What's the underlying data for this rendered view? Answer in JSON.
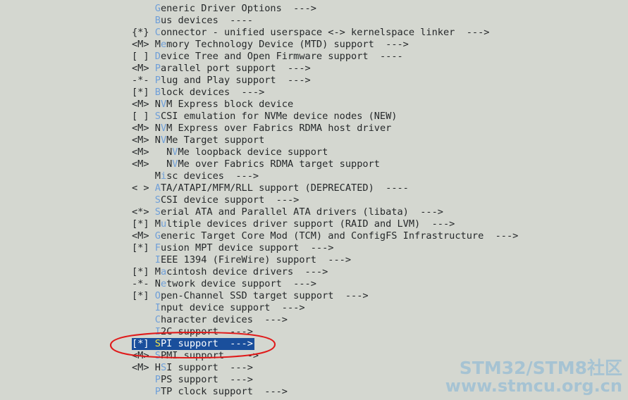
{
  "screen": {
    "kind": "linux-kernel-menuconfig",
    "background_color": "#d4d7d0",
    "text_color": "#25282a",
    "hotkey_color": "#6f9fd8",
    "selected_bg_color": "#1a4f9c",
    "selected_text_color": "#ffffff",
    "selected_hotkey_color": "#f2e64a",
    "annotation_color": "#e01b1b"
  },
  "menu": {
    "rows": [
      {
        "prefix": "    ",
        "pre_label": "",
        "hotkey": "G",
        "post_label": "eneric Driver Options",
        "arrow": "  --->",
        "selected": false
      },
      {
        "prefix": "    ",
        "pre_label": "",
        "hotkey": "B",
        "post_label": "us devices",
        "arrow": "  ----",
        "selected": false
      },
      {
        "prefix": "{*} ",
        "pre_label": "",
        "hotkey": "C",
        "post_label": "onnector - unified userspace <-> kernelspace linker",
        "arrow": "  --->",
        "selected": false
      },
      {
        "prefix": "<M> ",
        "pre_label": "M",
        "hotkey": "e",
        "post_label": "mory Technology Device (MTD) support",
        "arrow": "  --->",
        "selected": false
      },
      {
        "prefix": "[ ] ",
        "pre_label": "",
        "hotkey": "D",
        "post_label": "evice Tree and Open Firmware support",
        "arrow": "  ----",
        "selected": false
      },
      {
        "prefix": "<M> ",
        "pre_label": "",
        "hotkey": "P",
        "post_label": "arallel port support",
        "arrow": "  --->",
        "selected": false
      },
      {
        "prefix": "-*- ",
        "pre_label": "",
        "hotkey": "P",
        "post_label": "lug and Play support",
        "arrow": "  --->",
        "selected": false
      },
      {
        "prefix": "[*] ",
        "pre_label": "",
        "hotkey": "B",
        "post_label": "lock devices",
        "arrow": "  --->",
        "selected": false
      },
      {
        "prefix": "<M> ",
        "pre_label": "N",
        "hotkey": "V",
        "post_label": "M Express block device",
        "arrow": "",
        "selected": false
      },
      {
        "prefix": "[ ] ",
        "pre_label": "",
        "hotkey": "S",
        "post_label": "CSI emulation for NVMe device nodes (NEW)",
        "arrow": "",
        "selected": false
      },
      {
        "prefix": "<M> ",
        "pre_label": "N",
        "hotkey": "V",
        "post_label": "M Express over Fabrics RDMA host driver",
        "arrow": "",
        "selected": false
      },
      {
        "prefix": "<M> ",
        "pre_label": "N",
        "hotkey": "V",
        "post_label": "Me Target support",
        "arrow": "",
        "selected": false
      },
      {
        "prefix": "<M>   ",
        "pre_label": "N",
        "hotkey": "V",
        "post_label": "Me loopback device support",
        "arrow": "",
        "selected": false
      },
      {
        "prefix": "<M>   ",
        "pre_label": "N",
        "hotkey": "V",
        "post_label": "Me over Fabrics RDMA target support",
        "arrow": "",
        "selected": false
      },
      {
        "prefix": "    ",
        "pre_label": "M",
        "hotkey": "i",
        "post_label": "sc devices",
        "arrow": "  --->",
        "selected": false
      },
      {
        "prefix": "< > ",
        "pre_label": "",
        "hotkey": "A",
        "post_label": "TA/ATAPI/MFM/RLL support (DEPRECATED)",
        "arrow": "  ----",
        "selected": false
      },
      {
        "prefix": "    ",
        "pre_label": "",
        "hotkey": "S",
        "post_label": "CSI device support",
        "arrow": "  --->",
        "selected": false
      },
      {
        "prefix": "<*> ",
        "pre_label": "",
        "hotkey": "S",
        "post_label": "erial ATA and Parallel ATA drivers (libata)",
        "arrow": "  --->",
        "selected": false
      },
      {
        "prefix": "[*] ",
        "pre_label": "M",
        "hotkey": "u",
        "post_label": "ltiple devices driver support (RAID and LVM)",
        "arrow": "  --->",
        "selected": false
      },
      {
        "prefix": "<M> ",
        "pre_label": "",
        "hotkey": "G",
        "post_label": "eneric Target Core Mod (TCM) and ConfigFS Infrastructure",
        "arrow": "  --->",
        "selected": false
      },
      {
        "prefix": "[*] ",
        "pre_label": "",
        "hotkey": "F",
        "post_label": "usion MPT device support",
        "arrow": "  --->",
        "selected": false
      },
      {
        "prefix": "    ",
        "pre_label": "",
        "hotkey": "I",
        "post_label": "EEE 1394 (FireWire) support",
        "arrow": "  --->",
        "selected": false
      },
      {
        "prefix": "[*] ",
        "pre_label": "M",
        "hotkey": "a",
        "post_label": "cintosh device drivers",
        "arrow": "  --->",
        "selected": false
      },
      {
        "prefix": "-*- ",
        "pre_label": "N",
        "hotkey": "e",
        "post_label": "twork device support",
        "arrow": "  --->",
        "selected": false
      },
      {
        "prefix": "[*] ",
        "pre_label": "",
        "hotkey": "O",
        "post_label": "pen-Channel SSD target support",
        "arrow": "  --->",
        "selected": false
      },
      {
        "prefix": "    ",
        "pre_label": "",
        "hotkey": "I",
        "post_label": "nput device support",
        "arrow": "  --->",
        "selected": false
      },
      {
        "prefix": "    ",
        "pre_label": "",
        "hotkey": "C",
        "post_label": "haracter devices",
        "arrow": "  --->",
        "selected": false
      },
      {
        "prefix": "    ",
        "pre_label": "",
        "hotkey": "I",
        "post_label": "2C support",
        "arrow": "  --->",
        "selected": false
      },
      {
        "prefix": "[*] ",
        "pre_label": "",
        "hotkey": "S",
        "post_label": "PI support",
        "arrow": "  --->",
        "selected": true
      },
      {
        "prefix": "<M> ",
        "pre_label": "",
        "hotkey": "S",
        "post_label": "PMI support",
        "arrow": "  --->",
        "selected": false
      },
      {
        "prefix": "<M> ",
        "pre_label": "H",
        "hotkey": "S",
        "post_label": "I support",
        "arrow": "  --->",
        "selected": false
      },
      {
        "prefix": "    ",
        "pre_label": "",
        "hotkey": "P",
        "post_label": "PS support",
        "arrow": "  --->",
        "selected": false
      },
      {
        "prefix": "    ",
        "pre_label": "",
        "hotkey": "P",
        "post_label": "TP clock support",
        "arrow": "  --->",
        "selected": false
      }
    ]
  },
  "annotation": {
    "shape": "ellipse",
    "target_row_label": "SPI support",
    "color": "#e01b1b"
  },
  "watermark": {
    "line1": "STM32/STM8社区",
    "line2": "www.stmcu.org.cn",
    "color": "#a6c3d3"
  }
}
